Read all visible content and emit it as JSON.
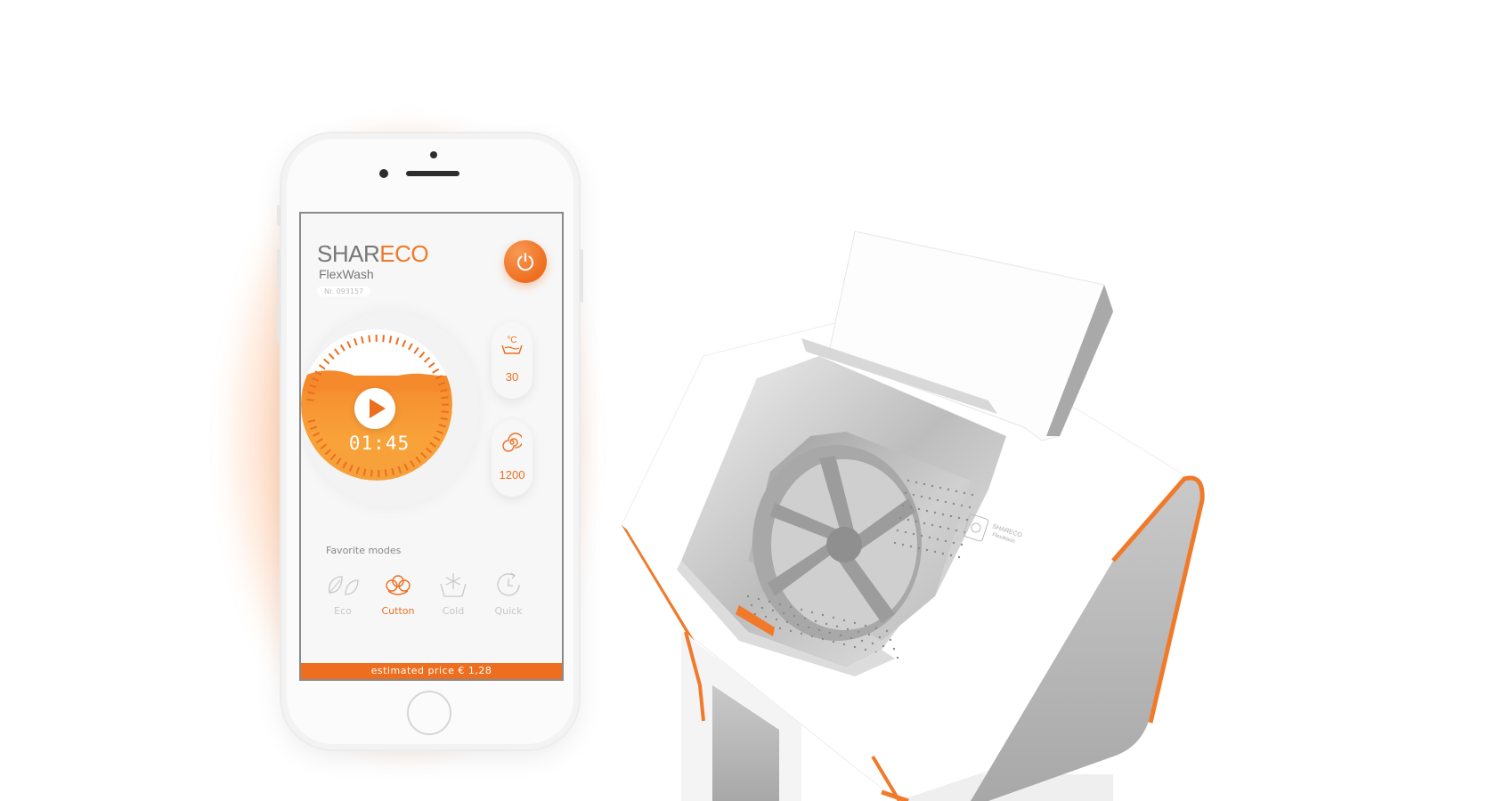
{
  "app": {
    "brand_prefix": "SHAR",
    "brand_suffix": "ECO",
    "model": "FlexWash",
    "serial": "Nr. 093157"
  },
  "program": {
    "timer": "01:45",
    "temperature_symbol": "°C",
    "temperature": "30",
    "spin": "1200"
  },
  "favorites": {
    "title": "Favorite modes",
    "modes": [
      {
        "label": "Eco",
        "icon": "leaf-icon",
        "active": false
      },
      {
        "label": "Cutton",
        "icon": "cotton-icon",
        "active": true
      },
      {
        "label": "Cold",
        "icon": "snowflake-icon",
        "active": false
      },
      {
        "label": "Quick",
        "icon": "quick-timer-icon",
        "active": false
      }
    ]
  },
  "price": {
    "text": "estimated price € 1,28"
  },
  "machine": {
    "panel_brand": "SHARECO",
    "panel_model": "FlexWash"
  },
  "colors": {
    "accent": "#ee6e1f",
    "glow": "#ff7a28",
    "background": "#ffffff"
  }
}
